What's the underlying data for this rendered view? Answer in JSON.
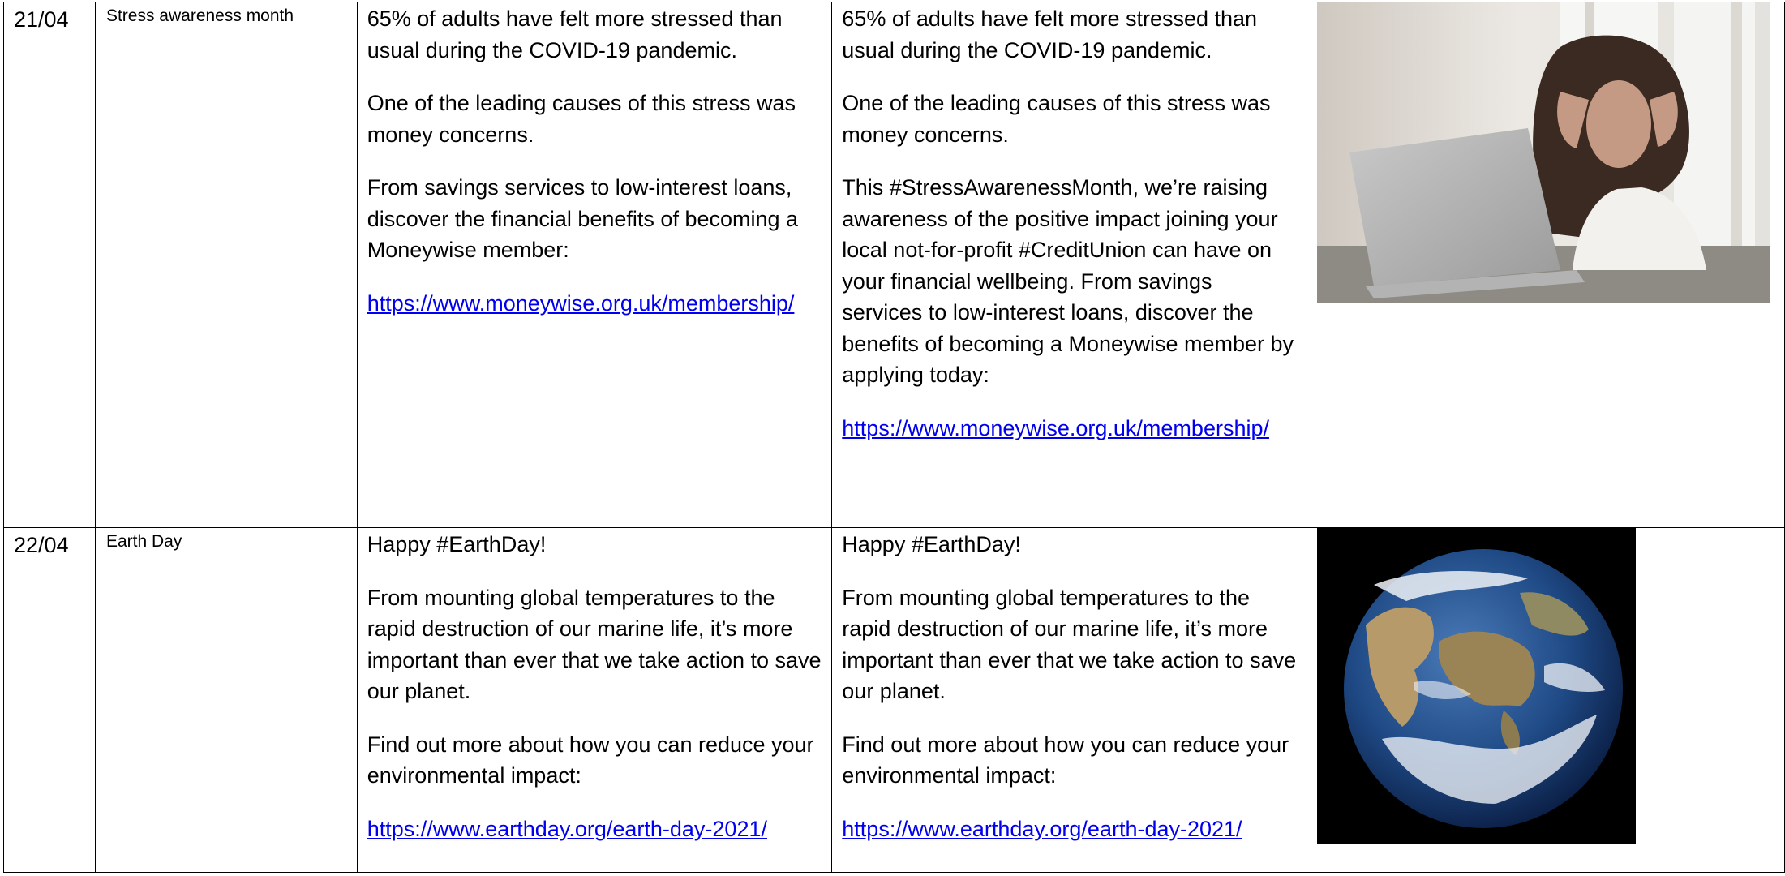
{
  "rows": [
    {
      "date": "21/04",
      "event": "Stress awareness month",
      "copy_a": {
        "paragraphs": [
          "65% of adults have felt more stressed than usual during the COVID-19 pandemic.",
          "One of the leading causes of this stress was money concerns.",
          "From savings services to low-interest loans, discover the financial benefits of becoming a Moneywise member:"
        ],
        "link": "https://www.moneywise.org.uk/membership/"
      },
      "copy_b": {
        "paragraphs": [
          "65% of adults have felt more stressed than usual during the COVID-19 pandemic.",
          "One of the leading causes of this stress was money concerns.",
          "This #StressAwarenessMonth, we’re raising awareness of the positive impact joining your local not-for-profit #CreditUnion can have on your financial wellbeing. From savings services to low-interest loans, discover the benefits of becoming a Moneywise member by applying today:"
        ],
        "link": "https://www.moneywise.org.uk/membership/"
      },
      "image": "stressed-woman-at-laptop-photo"
    },
    {
      "date": "22/04",
      "event": "Earth Day",
      "copy_a": {
        "paragraphs": [
          "Happy #EarthDay!",
          "From mounting global temperatures to the rapid destruction of our marine life, it’s more important than ever that we take action to save our planet.",
          "Find out more about how you can reduce your environmental impact:"
        ],
        "link": "https://www.earthday.org/earth-day-2021/"
      },
      "copy_b": {
        "paragraphs": [
          "Happy #EarthDay!",
          "From mounting global temperatures to the rapid destruction of our marine life, it’s more important than ever that we take action to save our planet.",
          "Find out more about how you can reduce your environmental impact:"
        ],
        "link": "https://www.earthday.org/earth-day-2021/"
      },
      "image": "planet-earth-photo"
    }
  ]
}
